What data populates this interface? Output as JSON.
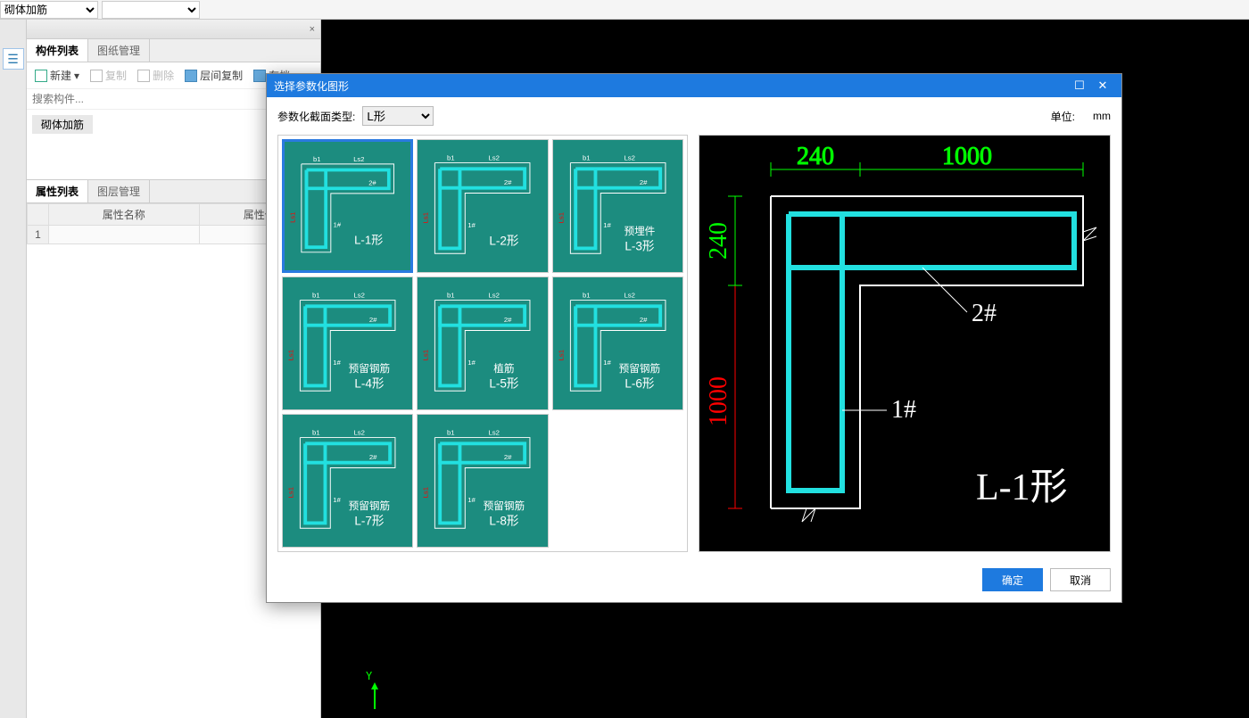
{
  "topbar": {
    "combo1": "砌体加筋",
    "combo2": ""
  },
  "side": {
    "close_x": "×",
    "tabs": {
      "components": "构件列表",
      "drawings": "图纸管理"
    },
    "toolbar": {
      "new": "新建",
      "copy": "复制",
      "delete": "删除",
      "layer_copy": "层间复制",
      "archive": "存档",
      "overflow": "»"
    },
    "search_placeholder": "搜索构件...",
    "tree_item": "砌体加筋",
    "prop_tabs": {
      "props": "属性列表",
      "layers": "图层管理"
    },
    "prop_headers": {
      "name": "属性名称",
      "value": "属性值"
    },
    "prop_rows": [
      {
        "num": "1",
        "name": "",
        "value": ""
      }
    ]
  },
  "dialog": {
    "title": "选择参数化图形",
    "section_label": "参数化截面类型:",
    "section_value": "L形",
    "unit_label": "单位:",
    "unit_value": "mm",
    "ok": "确定",
    "cancel": "取消",
    "win_max": "☐",
    "win_close": "✕",
    "shapes": [
      {
        "id": "L1",
        "label": "L-1形",
        "extra": ""
      },
      {
        "id": "L2",
        "label": "L-2形",
        "extra": ""
      },
      {
        "id": "L3",
        "label": "L-3形",
        "extra": "预埋件"
      },
      {
        "id": "L4",
        "label": "L-4形",
        "extra": "预留钢筋"
      },
      {
        "id": "L5",
        "label": "L-5形",
        "extra": "植筋"
      },
      {
        "id": "L6",
        "label": "L-6形",
        "extra": "预留钢筋"
      },
      {
        "id": "L7",
        "label": "L-7形",
        "extra": "预留钢筋"
      },
      {
        "id": "L8",
        "label": "L-8形",
        "extra": "预留钢筋"
      }
    ],
    "preview": {
      "top_dim1": "240",
      "top_dim2": "1000",
      "left_dim1": "240",
      "left_dim2": "1000",
      "mark1": "1#",
      "mark2": "2#",
      "name": "L-1形"
    }
  },
  "axis": {
    "y": "Y"
  }
}
